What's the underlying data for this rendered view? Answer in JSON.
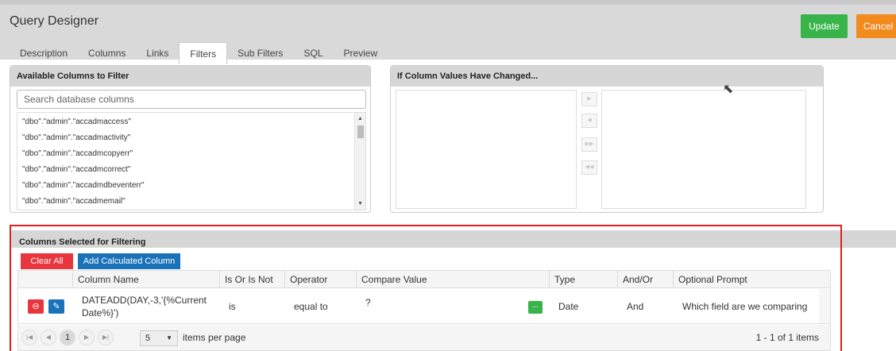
{
  "app": {
    "title": "Query Designer"
  },
  "actions": {
    "update": "Update",
    "cancel": "Cancel"
  },
  "tabs": [
    {
      "label": "Description"
    },
    {
      "label": "Columns"
    },
    {
      "label": "Links"
    },
    {
      "label": "Filters"
    },
    {
      "label": "Sub Filters"
    },
    {
      "label": "SQL"
    },
    {
      "label": "Preview"
    }
  ],
  "active_tab": "Filters",
  "available": {
    "title": "Available Columns to Filter",
    "search_placeholder": "Search database columns",
    "items": [
      "\"dbo\".\"admin\".\"accadmaccess\"",
      "\"dbo\".\"admin\".\"accadmactivity\"",
      "\"dbo\".\"admin\".\"accadmcopyerr\"",
      "\"dbo\".\"admin\".\"accadmcorrect\"",
      "\"dbo\".\"admin\".\"accadmdbeventerr\"",
      "\"dbo\".\"admin\".\"accadmemail\""
    ]
  },
  "changed": {
    "title": "If Column Values Have Changed...",
    "move_buttons": [
      "▶",
      "◀",
      "▶▶",
      "◀◀"
    ]
  },
  "selected": {
    "title": "Columns Selected for Filtering",
    "clear_all": "Clear All",
    "add_calculated": "Add Calculated Column",
    "columns": [
      "Column Name",
      "Is Or Is Not",
      "Operator",
      "Compare Value",
      "Type",
      "And/Or",
      "Optional Prompt"
    ],
    "rows": [
      {
        "column_name": "DATEADD(DAY,-3,'{%Current Date%}')",
        "is_or_is_not": "is",
        "operator": "equal to",
        "compare_value": "?",
        "type": "Date",
        "and_or": "And",
        "optional_prompt": "Which field are we comparing"
      }
    ]
  },
  "pager": {
    "first": "|◀",
    "prev": "◀",
    "current_page": "1",
    "next": "▶",
    "last": "▶|",
    "page_size": "5",
    "items_per_page_label": "items per page",
    "info": "1 - 1 of 1 items"
  },
  "colors": {
    "update": "#38b44a",
    "cancel": "#f28a1e",
    "clear": "#e8353e",
    "primary": "#1a73b8",
    "highlight_border": "#e02020"
  }
}
